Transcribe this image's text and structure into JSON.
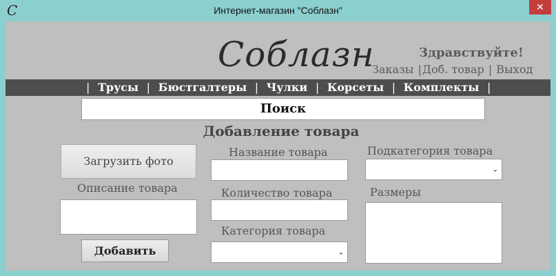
{
  "window": {
    "title": "Интернет-магазин \"Соблазн\"",
    "icon_glyph": "C",
    "close_glyph": "✕"
  },
  "header": {
    "logo_text": "Соблазн",
    "greeting": "Здравствуйте!",
    "links": [
      "Заказы",
      "Доб. товар",
      "Выход"
    ],
    "link_separator": "|"
  },
  "menu": {
    "separator": "|",
    "items": [
      "Трусы",
      "Бюстгалтеры",
      "Чулки",
      "Корсеты",
      "Комплекты"
    ]
  },
  "search": {
    "label": "Поиск"
  },
  "form": {
    "title": "Добавление товара",
    "upload_photo_button": "Загрузить фото",
    "description_label": "Описание товара",
    "name_label": "Название товара",
    "quantity_label": "Количество товара",
    "category_label": "Категория товара",
    "subcategory_label": "Подкатегория товара",
    "sizes_label": "Размеры",
    "add_button": "Добавить",
    "chevron_glyph": "⌄"
  },
  "colors": {
    "title_bar": "#8ccfcf",
    "client_bg": "#bfbfbf",
    "menu_bar": "#4d4d4d",
    "close_button": "#c43d3d"
  }
}
